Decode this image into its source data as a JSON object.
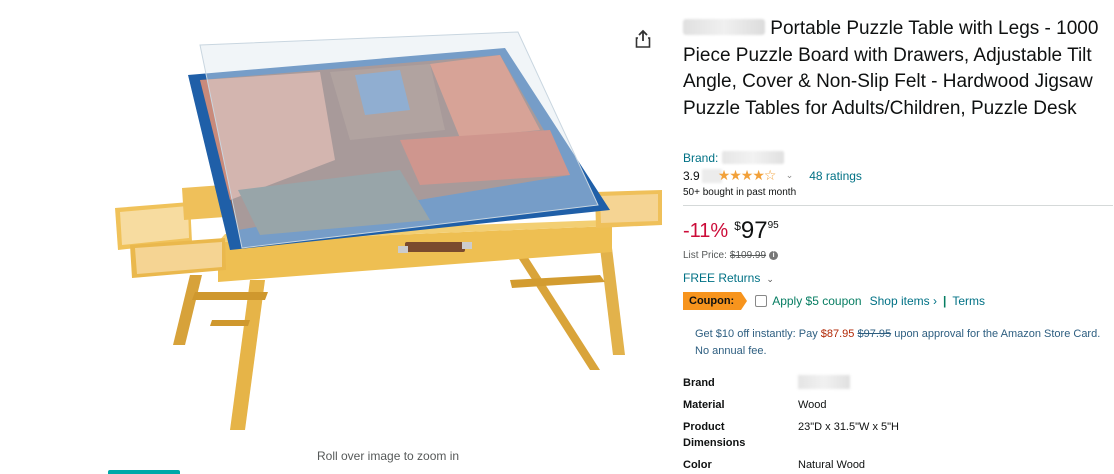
{
  "image_area": {
    "zoom_hint": "Roll over image to zoom in",
    "share_icon": "share-icon"
  },
  "product": {
    "title": "Portable Puzzle Table with Legs - 1000 Piece Puzzle Board with Drawers, Adjustable Tilt Angle, Cover & Non-Slip Felt - Hardwood Jigsaw Puzzle Tables for Adults/Children, Puzzle Desk",
    "brand_label": "Brand:",
    "rating_value": "3.9",
    "stars_display": "★★★★☆",
    "ratings_count": "48 ratings",
    "bought_text": "50+ bought in past month",
    "discount": "-11%",
    "price_symbol": "$",
    "price_whole": "97",
    "price_fraction": "95",
    "list_price_label": "List Price:",
    "list_price_value": "$109.99",
    "returns_label": "FREE Returns",
    "coupon_badge": "Coupon:",
    "coupon_apply": "Apply $5 coupon",
    "shop_items": "Shop items ›",
    "coupon_separator": "|",
    "terms": "Terms",
    "card_offer_prefix": "Get $10 off instantly: Pay",
    "card_offer_new_price": "$87.95",
    "card_offer_old_price": "$97.95",
    "card_offer_suffix": "upon approval for the Amazon Store Card. No annual fee."
  },
  "specs": [
    {
      "label": "Brand",
      "value": ""
    },
    {
      "label": "Material",
      "value": "Wood"
    },
    {
      "label": "Product Dimensions",
      "value": "23\"D x 31.5\"W x 5\"H"
    },
    {
      "label": "Color",
      "value": "Natural Wood"
    }
  ],
  "colors": {
    "link": "#007185",
    "discount_red": "#cc0c39",
    "coupon_orange": "#f7941d",
    "coupon_green": "#067d62",
    "star": "#f2a13a",
    "table_wood": "#e8b94a",
    "board_blue": "#1f5fa8"
  }
}
